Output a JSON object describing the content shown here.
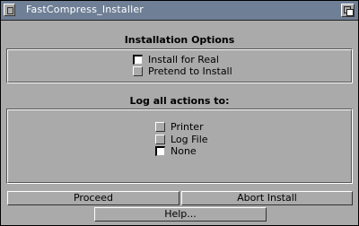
{
  "window": {
    "title": "FastCompress_Installer"
  },
  "install_options": {
    "heading": "Installation Options",
    "options": [
      {
        "label": "Install for Real",
        "checked": true
      },
      {
        "label": "Pretend to Install",
        "checked": false
      }
    ]
  },
  "log_options": {
    "heading": "Log all actions to:",
    "options": [
      {
        "label": "Printer",
        "checked": false
      },
      {
        "label": "Log File",
        "checked": false
      },
      {
        "label": "None",
        "checked": true
      }
    ]
  },
  "buttons": {
    "proceed": "Proceed",
    "abort": "Abort Install",
    "help": "Help..."
  },
  "colors": {
    "titlebar": "#6f7f96",
    "window_bg": "#aaaaaa"
  }
}
